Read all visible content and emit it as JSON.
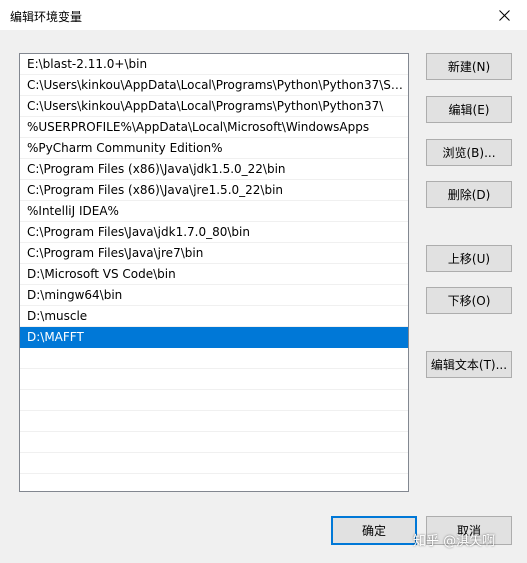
{
  "window": {
    "title": "编辑环境变量"
  },
  "paths": [
    {
      "text": "E:\\blast-2.11.0+\\bin",
      "selected": false
    },
    {
      "text": "C:\\Users\\kinkou\\AppData\\Local\\Programs\\Python\\Python37\\Scr...",
      "selected": false
    },
    {
      "text": "C:\\Users\\kinkou\\AppData\\Local\\Programs\\Python\\Python37\\",
      "selected": false
    },
    {
      "text": "%USERPROFILE%\\AppData\\Local\\Microsoft\\WindowsApps",
      "selected": false
    },
    {
      "text": "%PyCharm Community Edition%",
      "selected": false
    },
    {
      "text": "C:\\Program Files (x86)\\Java\\jdk1.5.0_22\\bin",
      "selected": false
    },
    {
      "text": "C:\\Program Files (x86)\\Java\\jre1.5.0_22\\bin",
      "selected": false
    },
    {
      "text": "%IntelliJ IDEA%",
      "selected": false
    },
    {
      "text": "C:\\Program Files\\Java\\jdk1.7.0_80\\bin",
      "selected": false
    },
    {
      "text": "C:\\Program Files\\Java\\jre7\\bin",
      "selected": false
    },
    {
      "text": "D:\\Microsoft VS Code\\bin",
      "selected": false
    },
    {
      "text": "D:\\mingw64\\bin",
      "selected": false
    },
    {
      "text": "D:\\muscle",
      "selected": false
    },
    {
      "text": "D:\\MAFFT",
      "selected": true
    }
  ],
  "buttons": {
    "new": "新建(N)",
    "edit": "编辑(E)",
    "browse": "浏览(B)...",
    "delete": "删除(D)",
    "move_up": "上移(U)",
    "move_down": "下移(O)",
    "edit_text": "编辑文本(T)...",
    "ok": "确定",
    "cancel": "取消"
  },
  "watermark": "知乎 @淇矢啊",
  "colors": {
    "selection": "#0078d7",
    "border": "#adadad",
    "background": "#f0f0f0"
  },
  "icons": {
    "close": "close-icon"
  }
}
